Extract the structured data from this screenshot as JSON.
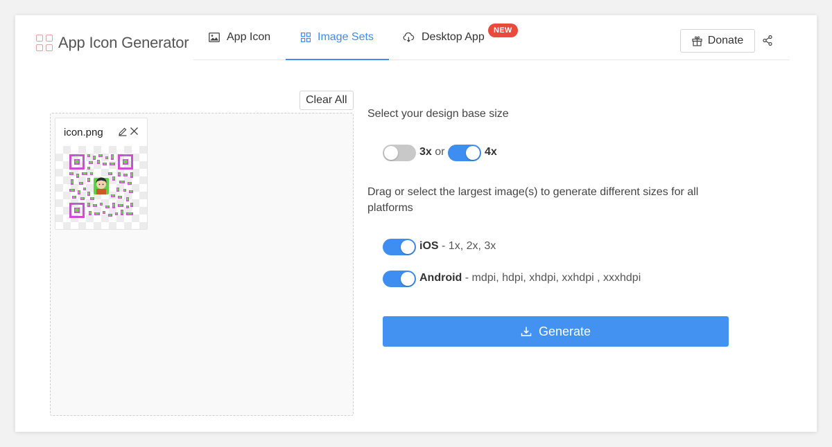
{
  "app": {
    "title": "App Icon Generator"
  },
  "nav": {
    "tabs": [
      {
        "label": "App Icon",
        "icon": "image-icon"
      },
      {
        "label": "Image Sets",
        "icon": "grid-icon",
        "active": true
      },
      {
        "label": "Desktop App",
        "icon": "cloud-download-icon"
      }
    ],
    "new_badge": "NEW",
    "donate_label": "Donate"
  },
  "upload": {
    "clear_all_label": "Clear All",
    "files": [
      {
        "name": "icon.png"
      }
    ]
  },
  "settings": {
    "base_size_prompt": "Select your design base size",
    "option_3x": "3x",
    "or_text": "or",
    "option_4x": "4x",
    "selected_base": "4x",
    "drag_prompt": "Drag or select the largest image(s) to generate different sizes for all platforms",
    "platforms": [
      {
        "name": "iOS",
        "sizes": "- 1x, 2x, 3x",
        "enabled": true
      },
      {
        "name": "Android",
        "sizes": "- mdpi, hdpi, xhdpi, xxhdpi , xxxhdpi",
        "enabled": true
      }
    ],
    "generate_label": "Generate"
  },
  "colors": {
    "accent": "#3d8ef0",
    "badge": "#e84a3c",
    "toggle_off": "#c8c8c8",
    "logo": "#e5a0a0"
  }
}
